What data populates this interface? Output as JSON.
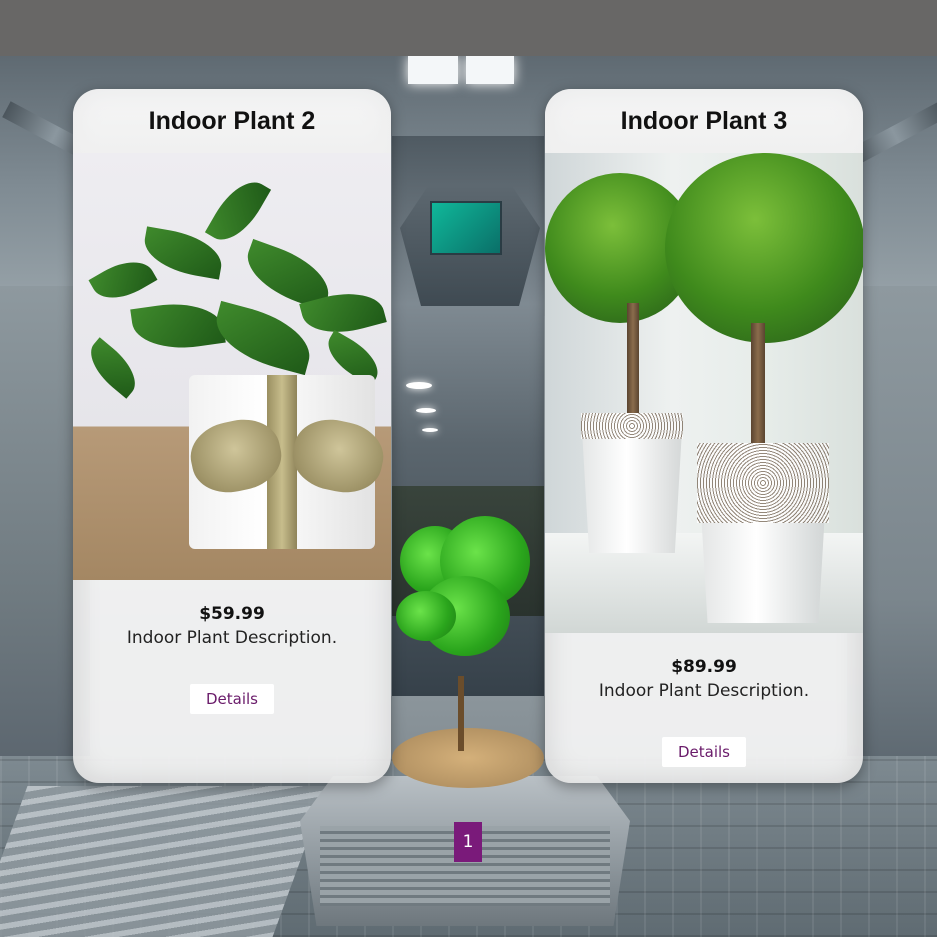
{
  "products": [
    {
      "title": "Indoor Plant 2",
      "price": "$59.99",
      "description": "Indoor Plant Description.",
      "details_label": "Details"
    },
    {
      "title": "Indoor Plant 3",
      "price": "$89.99",
      "description": "Indoor Plant Description.",
      "details_label": "Details"
    }
  ],
  "pagination": {
    "current_page": "1"
  },
  "colors": {
    "accent": "#7a1a7a",
    "details_text": "#6a1b6a",
    "top_bar": "#686766"
  }
}
